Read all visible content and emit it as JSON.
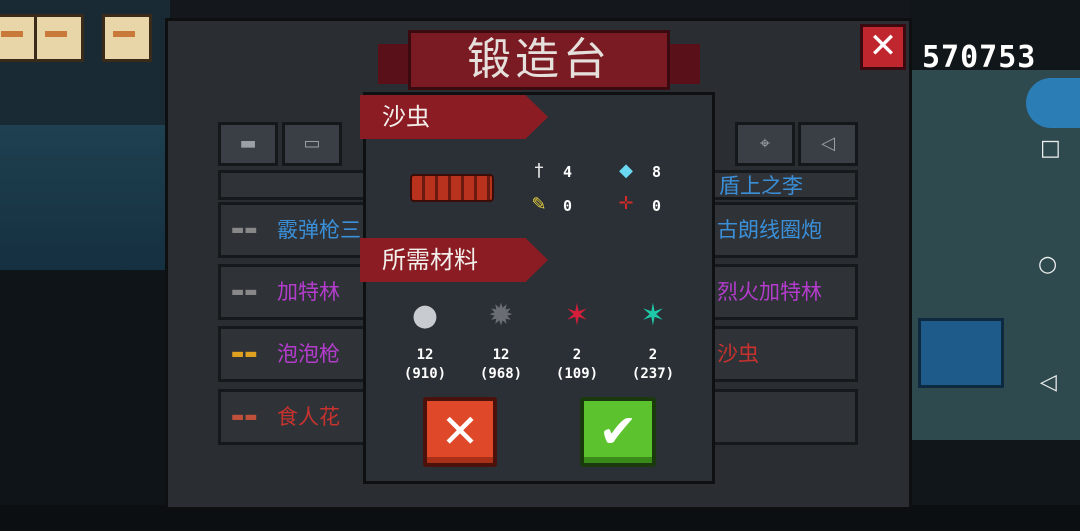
{
  "header": {
    "title": "锻造台",
    "score": "570753",
    "close_symbol": "✕"
  },
  "tabs": [
    {
      "icon": "smg-icon",
      "glyph": "▬"
    },
    {
      "icon": "rifle-icon",
      "glyph": "▭"
    },
    {
      "icon": "crosshair-icon",
      "glyph": "⌖"
    },
    {
      "icon": "shark-gun-icon",
      "glyph": "◁"
    }
  ],
  "weapon_list": {
    "left_rows": [
      {
        "label": "霰弹枪三",
        "color": "#3a8fd8"
      },
      {
        "label": "加特林",
        "color": "#b43ccc"
      },
      {
        "label": "泡泡枪",
        "color": "#b43ccc"
      },
      {
        "label": "食人花",
        "color": "#c8322e"
      }
    ],
    "right_rows": [
      {
        "label": "盾上之李",
        "color": "#3a8fd8"
      },
      {
        "label": "古朗线圈炮",
        "color": "#3a8fd8"
      },
      {
        "label": "烈火加特林",
        "color": "#b43ccc"
      },
      {
        "label": "沙虫",
        "color": "#c8322e"
      }
    ]
  },
  "popup": {
    "weapon_name": "沙虫",
    "stats": {
      "damage": "4",
      "energy_cost": "8",
      "crit": "0",
      "spread": "0"
    },
    "materials_title": "所需材料",
    "materials": [
      {
        "icon": "ore-icon",
        "glyph": "●",
        "color": "#c8ccd0",
        "required": "12",
        "owned": "(910)"
      },
      {
        "icon": "gear-part-icon",
        "glyph": "✹",
        "color": "#6a6e74",
        "required": "12",
        "owned": "(968)"
      },
      {
        "icon": "red-crystal-icon",
        "glyph": "✶",
        "color": "#d41e3a",
        "required": "2",
        "owned": "(109)"
      },
      {
        "icon": "green-crystal-icon",
        "glyph": "✶",
        "color": "#1ec8a8",
        "required": "2",
        "owned": "(237)"
      }
    ],
    "cancel_symbol": "✕",
    "confirm_symbol": "✔"
  },
  "system_nav": {
    "recent": "□",
    "home": "○",
    "back": "◁"
  }
}
